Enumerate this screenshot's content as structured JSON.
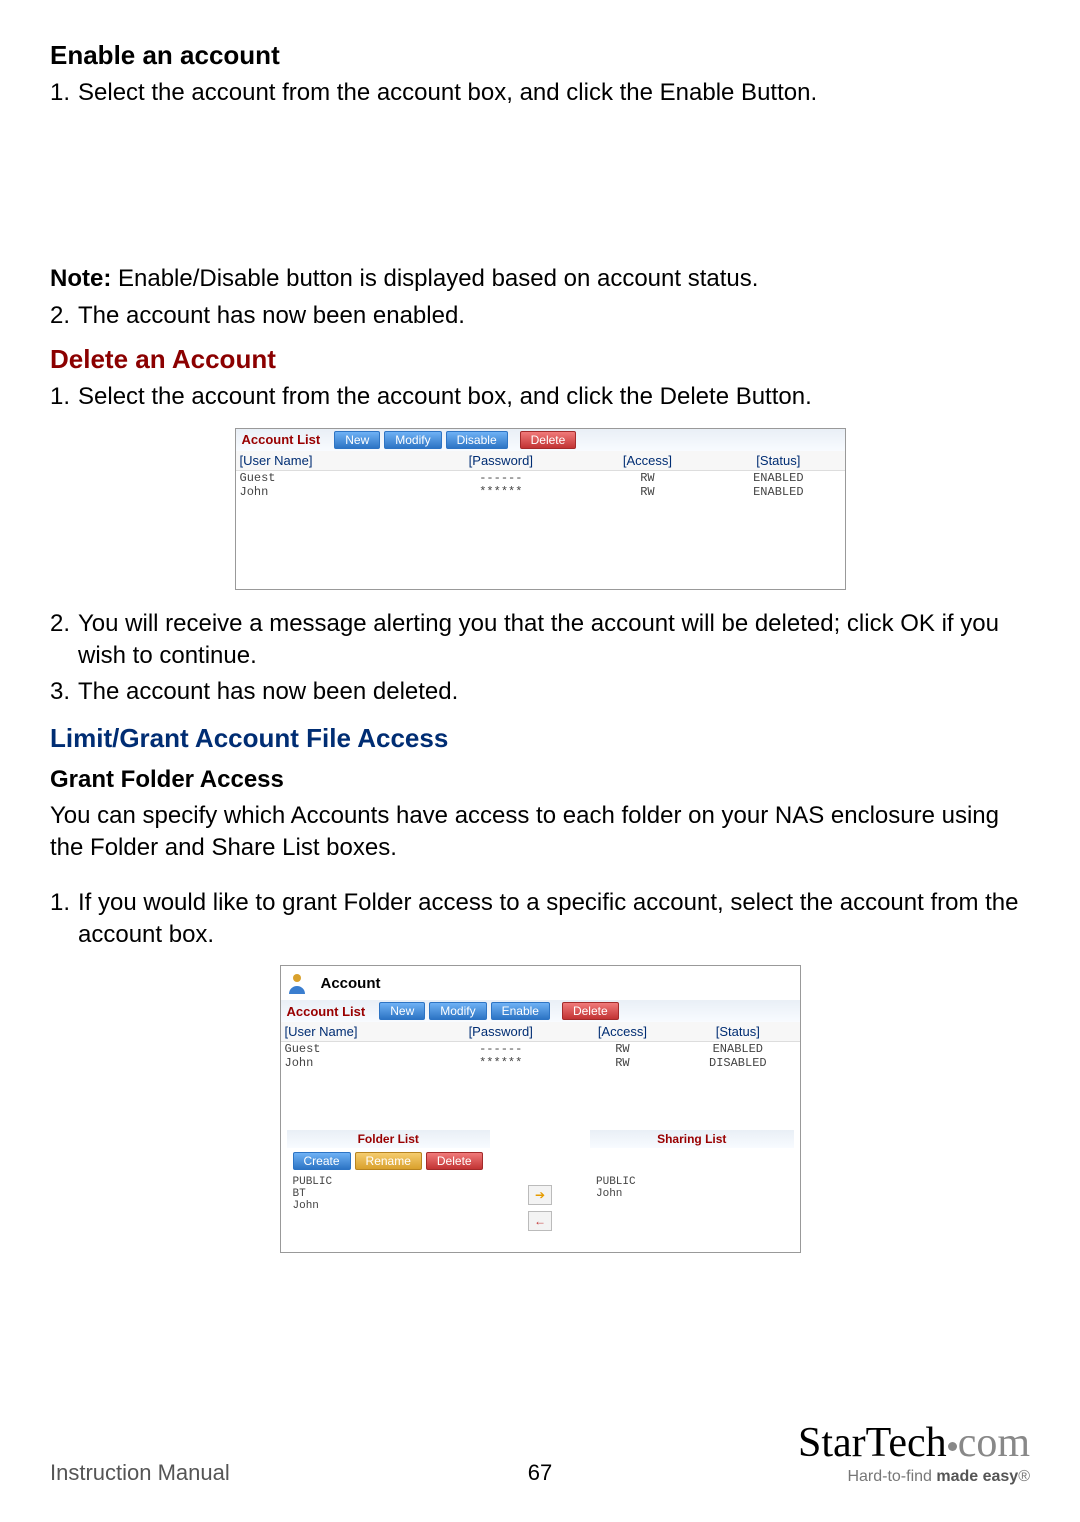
{
  "headings": {
    "enable": "Enable an account",
    "delete": "Delete an Account",
    "limit": "Limit/Grant Account File Access",
    "grant": "Grant Folder Access"
  },
  "body": {
    "enable_step1": "Select the account from the account box, and click the Enable Button.",
    "note_prefix": "Note:",
    "note_text": " Enable/Disable button is displayed based on account status.",
    "enable_step2": "The account has now been enabled.",
    "delete_step1": "Select the account from the account box, and click the Delete Button.",
    "delete_step2": "You will receive a message alerting you that the account will be deleted; click OK if you wish to continue.",
    "delete_step3": "The account has now been deleted.",
    "grant_intro": "You can specify which Accounts have access to each folder on your NAS enclosure using the Folder and Share List boxes.",
    "grant_step1": "If you would like to grant Folder access to a specific account, select the account from the account box."
  },
  "shot1": {
    "title": "Account List",
    "buttons": {
      "new": "New",
      "modify": "Modify",
      "disable": "Disable",
      "delete": "Delete"
    },
    "cols": {
      "user": "[User Name]",
      "pass": "[Password]",
      "access": "[Access]",
      "status": "[Status]"
    },
    "rows": [
      {
        "user": "Guest",
        "pass": "------",
        "access": "RW",
        "status": "ENABLED"
      },
      {
        "user": "John",
        "pass": "******",
        "access": "RW",
        "status": "ENABLED"
      }
    ]
  },
  "shot2": {
    "header": "Account",
    "title": "Account List",
    "buttons": {
      "new": "New",
      "modify": "Modify",
      "enable": "Enable",
      "delete": "Delete"
    },
    "cols": {
      "user": "[User Name]",
      "pass": "[Password]",
      "access": "[Access]",
      "status": "[Status]"
    },
    "rows": [
      {
        "user": "Guest",
        "pass": "------",
        "access": "RW",
        "status": "ENABLED"
      },
      {
        "user": "John",
        "pass": "******",
        "access": "RW",
        "status": "DISABLED"
      }
    ],
    "folder_list_label": "Folder List",
    "sharing_list_label": "Sharing List",
    "folder_buttons": {
      "create": "Create",
      "rename": "Rename",
      "delete": "Delete"
    },
    "folder_items": [
      "PUBLIC",
      "BT",
      "John"
    ],
    "sharing_items": [
      "PUBLIC",
      "John"
    ]
  },
  "footer": {
    "left": "Instruction Manual",
    "page": "67",
    "brand1": "StarTech",
    "brand2": "com",
    "tag_a": "Hard-to-find ",
    "tag_b": "made easy",
    "tag_c": "®"
  },
  "num": {
    "n1": "1.",
    "n2": "2.",
    "n3": "3."
  }
}
